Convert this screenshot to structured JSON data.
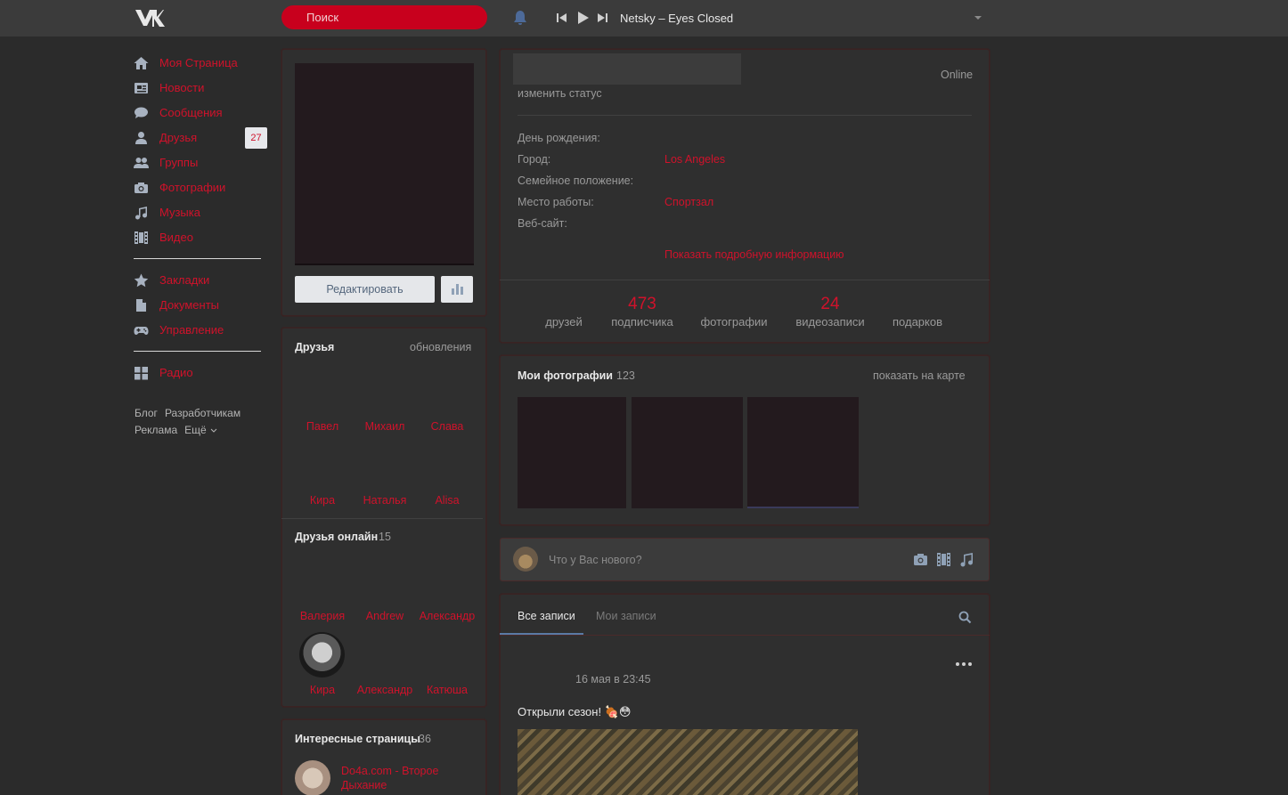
{
  "header": {
    "search_placeholder": "Поиск",
    "track": "Netsky – Eyes Closed"
  },
  "nav": {
    "items": [
      {
        "label": "Моя Страница",
        "icon": "home-icon"
      },
      {
        "label": "Новости",
        "icon": "news-icon"
      },
      {
        "label": "Сообщения",
        "icon": "messages-icon"
      },
      {
        "label": "Друзья",
        "icon": "user-icon",
        "badge": "27"
      },
      {
        "label": "Группы",
        "icon": "groups-icon"
      },
      {
        "label": "Фотографии",
        "icon": "camera-icon"
      },
      {
        "label": "Музыка",
        "icon": "music-icon"
      },
      {
        "label": "Видео",
        "icon": "video-icon"
      }
    ],
    "items2": [
      {
        "label": "Закладки",
        "icon": "star-icon"
      },
      {
        "label": "Документы",
        "icon": "document-icon"
      },
      {
        "label": "Управление",
        "icon": "gamepad-icon"
      }
    ],
    "items3": [
      {
        "label": "Радио",
        "icon": "grid-icon"
      }
    ],
    "footer": {
      "blog": "Блог",
      "dev": "Разработчикам",
      "ads": "Реклама",
      "more": "Ещё"
    }
  },
  "profile": {
    "edit_button": "Редактировать",
    "status_link": "изменить статус",
    "online": "Online",
    "info": [
      {
        "label": "День рождения:",
        "value": ""
      },
      {
        "label": "Город:",
        "value": "Los Angeles"
      },
      {
        "label": "Семейное положение:",
        "value": ""
      },
      {
        "label": "Место работы:",
        "value": "Спортзал"
      },
      {
        "label": "Веб-сайт:",
        "value": ""
      }
    ],
    "show_more": "Показать подробную информацию",
    "counters": [
      {
        "num": "",
        "cap": "друзей"
      },
      {
        "num": "473",
        "cap": "подписчика"
      },
      {
        "num": "",
        "cap": "фотографии"
      },
      {
        "num": "24",
        "cap": "видеозаписи"
      },
      {
        "num": "",
        "cap": "подарков"
      }
    ]
  },
  "friends": {
    "title": "Друзья",
    "updates": "обновления",
    "names": [
      "Павел",
      "Михаил",
      "Слава",
      "Кира",
      "Наталья",
      "Alisa"
    ]
  },
  "friends_online": {
    "title": "Друзья онлайн",
    "count": "15",
    "names": [
      "Валерия",
      "Andrew",
      "Александр",
      "Кира",
      "Александр",
      "Катюша"
    ]
  },
  "pages": {
    "title": "Интересные страницы",
    "count": "36",
    "first": "Do4a.com - Второе Дыхание"
  },
  "photos": {
    "title": "Мои фотографии",
    "count": "123",
    "map_link": "показать на карте"
  },
  "composer": {
    "placeholder": "Что у Вас нового?"
  },
  "wall": {
    "tab_all": "Все записи",
    "tab_mine": "Мои записи",
    "post_date": "16 мая в 23:45",
    "post_text": "Открыли сезон! 🍖😳"
  },
  "colors": {
    "accent": "#d0122b",
    "background": "#2b2b2b",
    "header": "#3b3b3b"
  }
}
